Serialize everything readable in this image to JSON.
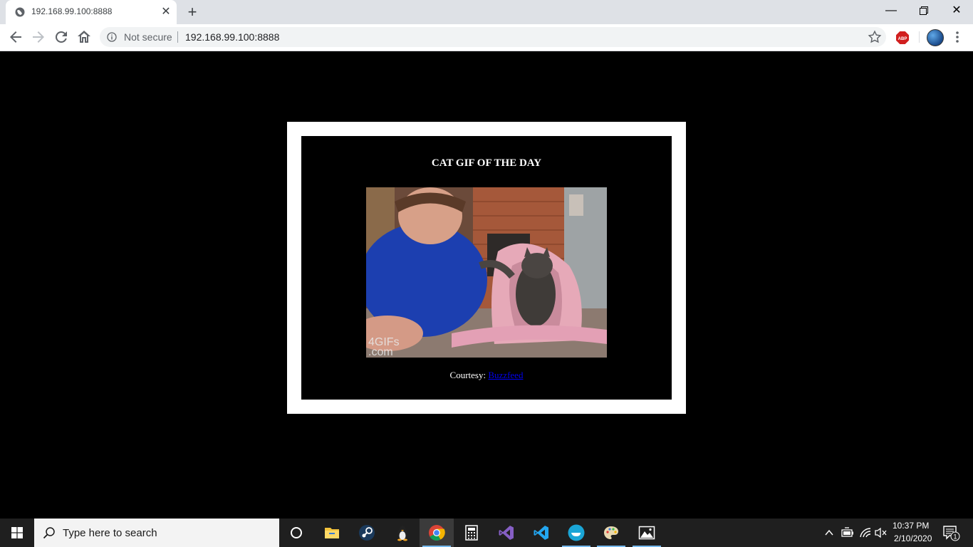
{
  "browser": {
    "tab": {
      "title": "192.168.99.100:8888",
      "favicon": "globe-icon"
    },
    "omnibox": {
      "security_label": "Not secure",
      "url": "192.168.99.100:8888"
    },
    "extensions": {
      "adblock_label": "ABP"
    }
  },
  "page": {
    "background": "#000000",
    "card_border_color": "#ffffff",
    "heading": "CAT GIF OF THE DAY",
    "gif_watermark_line1": "4GIFs",
    "gif_watermark_line2": ".com",
    "courtesy_label": "Courtesy:",
    "courtesy_link": "Buzzfeed",
    "link_color": "#0000ee"
  },
  "taskbar": {
    "search_placeholder": "Type here to search",
    "pinned_apps": [
      "cortana-icon",
      "file-explorer-icon",
      "steam-icon",
      "linux-penguin-icon",
      "chrome-icon",
      "calculator-icon",
      "visual-studio-icon",
      "vscode-icon",
      "docker-icon",
      "paint-icon",
      "photos-icon"
    ],
    "clock_time": "10:37 PM",
    "clock_date": "2/10/2020",
    "notification_count": "1"
  }
}
